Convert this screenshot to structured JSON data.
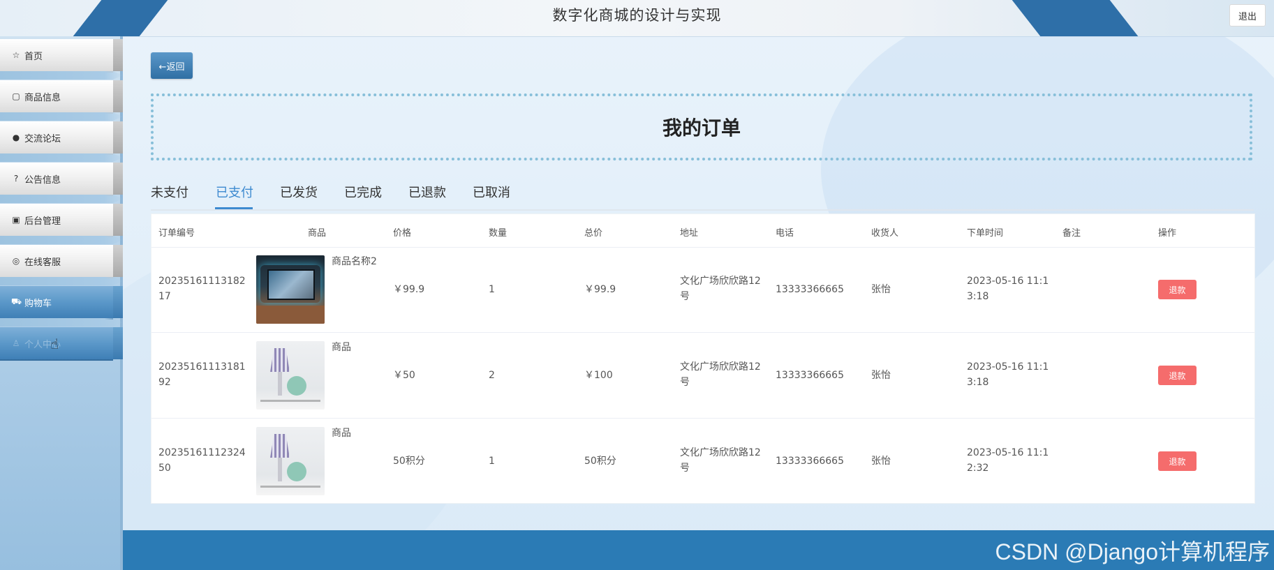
{
  "header": {
    "title": "数字化商城的设计与实现",
    "logout_label": "退出"
  },
  "sidebar": {
    "items": [
      {
        "label": "首页",
        "icon": "☆"
      },
      {
        "label": "商品信息",
        "icon": "▢"
      },
      {
        "label": "交流论坛",
        "icon": "●"
      },
      {
        "label": "公告信息",
        "icon": "?"
      },
      {
        "label": "后台管理",
        "icon": "▣"
      },
      {
        "label": "在线客服",
        "icon": "◎"
      },
      {
        "label": "购物车",
        "icon": "⛟"
      },
      {
        "label": "个人中心",
        "icon": "♙"
      }
    ]
  },
  "main": {
    "back_label": "←返回",
    "page_title": "我的订单",
    "tabs": [
      "未支付",
      "已支付",
      "已发货",
      "已完成",
      "已退款",
      "已取消"
    ],
    "columns": [
      "订单编号",
      "商品",
      "价格",
      "数量",
      "总价",
      "地址",
      "电话",
      "收货人",
      "下单时间",
      "备注",
      "操作"
    ],
    "orders": [
      {
        "order_no_1": "20235161113182",
        "order_no_2": "17",
        "product": "商品名称2",
        "price": "￥99.9",
        "qty": "1",
        "total": "￥99.9",
        "addr_1": "文化广场欣欣路12",
        "addr_2": "号",
        "phone": "13333366665",
        "receiver": "张怡",
        "time_1": "2023-05-16 11:1",
        "time_2": "3:18",
        "remark": "",
        "action": "退款"
      },
      {
        "order_no_1": "20235161113181",
        "order_no_2": "92",
        "product": "商品",
        "price": "￥50",
        "qty": "2",
        "total": "￥100",
        "addr_1": "文化广场欣欣路12",
        "addr_2": "号",
        "phone": "13333366665",
        "receiver": "张怡",
        "time_1": "2023-05-16 11:1",
        "time_2": "3:18",
        "remark": "",
        "action": "退款"
      },
      {
        "order_no_1": "20235161112324",
        "order_no_2": "50",
        "product": "商品",
        "price": "50积分",
        "qty": "1",
        "total": "50积分",
        "addr_1": "文化广场欣欣路12",
        "addr_2": "号",
        "phone": "13333366665",
        "receiver": "张怡",
        "time_1": "2023-05-16 11:1",
        "time_2": "2:32",
        "remark": "",
        "action": "退款"
      }
    ]
  },
  "footer": {
    "watermark": "CSDN @Django计算机程序"
  },
  "colors": {
    "accent": "#3d8ad0",
    "danger": "#f56c6c",
    "footer": "#2b7bb5"
  }
}
